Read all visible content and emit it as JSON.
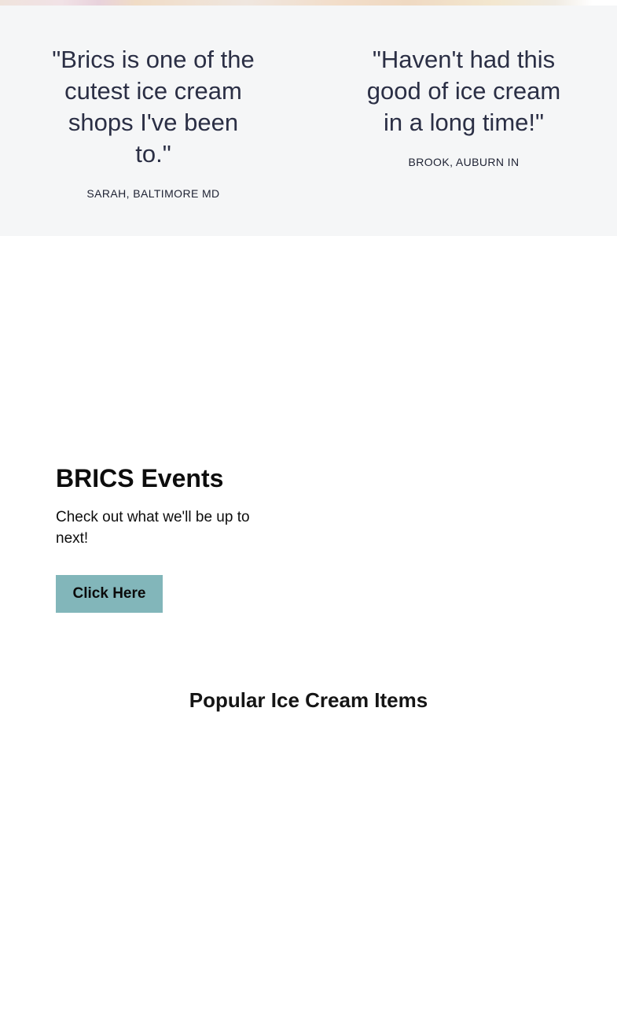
{
  "testimonials": [
    {
      "quote": "\"Brics is one of the cutest ice cream shops I've been to.\"",
      "author": "SARAH, BALTIMORE MD"
    },
    {
      "quote": "\"Haven't had this good of ice cream in a long time!\"",
      "author": "BROOK, AUBURN IN"
    }
  ],
  "events": {
    "title": "BRICS Events",
    "text": "Check out what we'll be up to next!",
    "button_label": "Click Here"
  },
  "popular": {
    "title": "Popular Ice Cream Items"
  },
  "colors": {
    "testimonial_background": "#f5f6f7",
    "button_background": "#82b6ba",
    "quote_text": "#2b2f45"
  }
}
